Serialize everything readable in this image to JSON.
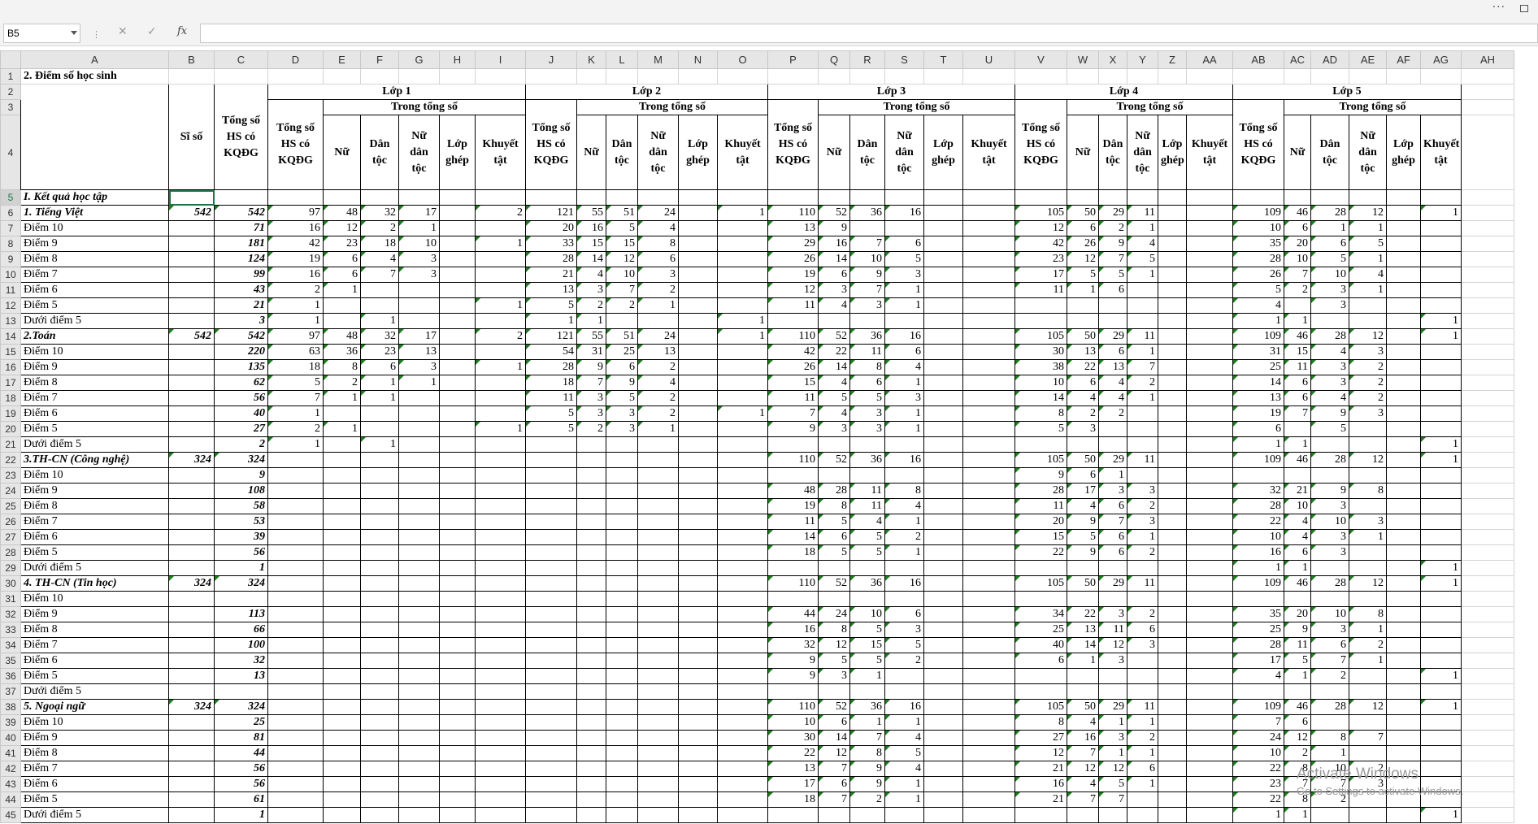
{
  "formula_bar": {
    "name_box": "B5",
    "fx": "fx",
    "formula": ""
  },
  "columns": [
    "A",
    "B",
    "C",
    "D",
    "E",
    "F",
    "G",
    "H",
    "I",
    "J",
    "K",
    "L",
    "M",
    "N",
    "O",
    "P",
    "Q",
    "R",
    "S",
    "T",
    "U",
    "V",
    "W",
    "X",
    "Y",
    "Z",
    "AA",
    "AB",
    "AC",
    "AD",
    "AE",
    "AF",
    "AG",
    "AH"
  ],
  "sheet_title": "2. Điểm số học sinh",
  "header": {
    "si_so": "Sĩ số",
    "tong_so": "Tổng số HS có KQĐG",
    "trong_tong_so": "Trong tổng số",
    "sub": [
      "Nữ",
      "Dân tộc",
      "Nữ dân tộc",
      "Lớp ghép",
      "Khuyết tật"
    ],
    "classes": [
      "Lớp 1",
      "Lớp 2",
      "Lớp 3",
      "Lớp 4",
      "Lớp 5"
    ]
  },
  "rows": [
    {
      "n": 5,
      "label": "I. Kết quả học tập",
      "style": "bi",
      "v": []
    },
    {
      "n": 6,
      "label": "1. Tiếng Việt",
      "style": "bi",
      "v": [
        "542",
        "542",
        "97",
        "48",
        "32",
        "17",
        "",
        "2",
        "121",
        "55",
        "51",
        "24",
        "",
        "1",
        "110",
        "52",
        "36",
        "16",
        "",
        "",
        "105",
        "50",
        "29",
        "11",
        "",
        "",
        "109",
        "46",
        "28",
        "12",
        "",
        "1"
      ]
    },
    {
      "n": 7,
      "label": "Điểm 10",
      "v": [
        "",
        "71",
        "16",
        "12",
        "2",
        "1",
        "",
        "",
        "20",
        "16",
        "5",
        "4",
        "",
        "",
        "13",
        "9",
        "",
        "",
        "",
        "",
        "12",
        "6",
        "2",
        "1",
        "",
        "",
        "10",
        "6",
        "1",
        "1",
        "",
        ""
      ]
    },
    {
      "n": 8,
      "label": "Điểm 9",
      "v": [
        "",
        "181",
        "42",
        "23",
        "18",
        "10",
        "",
        "1",
        "33",
        "15",
        "15",
        "8",
        "",
        "",
        "29",
        "16",
        "7",
        "6",
        "",
        "",
        "42",
        "26",
        "9",
        "4",
        "",
        "",
        "35",
        "20",
        "6",
        "5",
        "",
        ""
      ]
    },
    {
      "n": 9,
      "label": "Điểm 8",
      "v": [
        "",
        "124",
        "19",
        "6",
        "4",
        "3",
        "",
        "",
        "28",
        "14",
        "12",
        "6",
        "",
        "",
        "26",
        "14",
        "10",
        "5",
        "",
        "",
        "23",
        "12",
        "7",
        "5",
        "",
        "",
        "28",
        "10",
        "5",
        "1",
        "",
        ""
      ]
    },
    {
      "n": 10,
      "label": "Điểm 7",
      "v": [
        "",
        "99",
        "16",
        "6",
        "7",
        "3",
        "",
        "",
        "21",
        "4",
        "10",
        "3",
        "",
        "",
        "19",
        "6",
        "9",
        "3",
        "",
        "",
        "17",
        "5",
        "5",
        "1",
        "",
        "",
        "26",
        "7",
        "10",
        "4",
        "",
        ""
      ]
    },
    {
      "n": 11,
      "label": "Điểm 6",
      "v": [
        "",
        "43",
        "2",
        "1",
        "",
        "",
        "",
        "",
        "13",
        "3",
        "7",
        "2",
        "",
        "",
        "12",
        "3",
        "7",
        "1",
        "",
        "",
        "11",
        "1",
        "6",
        "",
        "",
        "",
        "5",
        "2",
        "3",
        "1",
        "",
        ""
      ]
    },
    {
      "n": 12,
      "label": "Điểm 5",
      "v": [
        "",
        "21",
        "1",
        "",
        "",
        "",
        "",
        "1",
        "5",
        "2",
        "2",
        "1",
        "",
        "",
        "11",
        "4",
        "3",
        "1",
        "",
        "",
        "",
        "",
        "",
        "",
        "",
        "",
        "4",
        "",
        "3",
        "",
        "",
        ""
      ]
    },
    {
      "n": 13,
      "label": "Dưới điểm 5",
      "v": [
        "",
        "3",
        "1",
        "",
        "1",
        "",
        "",
        "",
        "1",
        "1",
        "",
        "",
        "",
        "1",
        "",
        "",
        "",
        "",
        "",
        "",
        "",
        "",
        "",
        "",
        "",
        "",
        "1",
        "1",
        "",
        "",
        "",
        "1"
      ]
    },
    {
      "n": 14,
      "label": "2.Toán",
      "style": "bi",
      "v": [
        "542",
        "542",
        "97",
        "48",
        "32",
        "17",
        "",
        "2",
        "121",
        "55",
        "51",
        "24",
        "",
        "1",
        "110",
        "52",
        "36",
        "16",
        "",
        "",
        "105",
        "50",
        "29",
        "11",
        "",
        "",
        "109",
        "46",
        "28",
        "12",
        "",
        "1"
      ]
    },
    {
      "n": 15,
      "label": "Điểm 10",
      "v": [
        "",
        "220",
        "63",
        "36",
        "23",
        "13",
        "",
        "",
        "54",
        "31",
        "25",
        "13",
        "",
        "",
        "42",
        "22",
        "11",
        "6",
        "",
        "",
        "30",
        "13",
        "6",
        "1",
        "",
        "",
        "31",
        "15",
        "4",
        "3",
        "",
        ""
      ]
    },
    {
      "n": 16,
      "label": "Điểm 9",
      "v": [
        "",
        "135",
        "18",
        "8",
        "6",
        "3",
        "",
        "1",
        "28",
        "9",
        "6",
        "2",
        "",
        "",
        "26",
        "14",
        "8",
        "4",
        "",
        "",
        "38",
        "22",
        "13",
        "7",
        "",
        "",
        "25",
        "11",
        "3",
        "2",
        "",
        ""
      ]
    },
    {
      "n": 17,
      "label": "Điểm 8",
      "v": [
        "",
        "62",
        "5",
        "2",
        "1",
        "1",
        "",
        "",
        "18",
        "7",
        "9",
        "4",
        "",
        "",
        "15",
        "4",
        "6",
        "1",
        "",
        "",
        "10",
        "6",
        "4",
        "2",
        "",
        "",
        "14",
        "6",
        "3",
        "2",
        "",
        ""
      ]
    },
    {
      "n": 18,
      "label": "Điểm 7",
      "v": [
        "",
        "56",
        "7",
        "1",
        "1",
        "",
        "",
        "",
        "11",
        "3",
        "5",
        "2",
        "",
        "",
        "11",
        "5",
        "5",
        "3",
        "",
        "",
        "14",
        "4",
        "4",
        "1",
        "",
        "",
        "13",
        "6",
        "4",
        "2",
        "",
        ""
      ]
    },
    {
      "n": 19,
      "label": "Điểm 6",
      "v": [
        "",
        "40",
        "1",
        "",
        "",
        "",
        "",
        "",
        "5",
        "3",
        "3",
        "2",
        "",
        "1",
        "7",
        "4",
        "3",
        "1",
        "",
        "",
        "8",
        "2",
        "2",
        "",
        "",
        "",
        "19",
        "7",
        "9",
        "3",
        "",
        ""
      ]
    },
    {
      "n": 20,
      "label": "Điểm 5",
      "v": [
        "",
        "27",
        "2",
        "1",
        "",
        "",
        "",
        "1",
        "5",
        "2",
        "3",
        "1",
        "",
        "",
        "9",
        "3",
        "3",
        "1",
        "",
        "",
        "5",
        "3",
        "",
        "",
        "",
        "",
        "6",
        "",
        "5",
        "",
        "",
        ""
      ]
    },
    {
      "n": 21,
      "label": "Dưới điểm 5",
      "v": [
        "",
        "2",
        "1",
        "",
        "1",
        "",
        "",
        "",
        "",
        "",
        "",
        "",
        "",
        "",
        "",
        "",
        "",
        "",
        "",
        "",
        "",
        "",
        "",
        "",
        "",
        "",
        "1",
        "1",
        "",
        "",
        "",
        "1"
      ]
    },
    {
      "n": 22,
      "label": "3.TH-CN (Công nghệ)",
      "style": "bi",
      "v": [
        "324",
        "324",
        "",
        "",
        "",
        "",
        "",
        "",
        "",
        "",
        "",
        "",
        "",
        "",
        "110",
        "52",
        "36",
        "16",
        "",
        "",
        "105",
        "50",
        "29",
        "11",
        "",
        "",
        "109",
        "46",
        "28",
        "12",
        "",
        "1"
      ]
    },
    {
      "n": 23,
      "label": "Điểm 10",
      "v": [
        "",
        "9",
        "",
        "",
        "",
        "",
        "",
        "",
        "",
        "",
        "",
        "",
        "",
        "",
        "",
        "",
        "",
        "",
        "",
        "",
        "9",
        "6",
        "1",
        "",
        "",
        "",
        "",
        "",
        "",
        "",
        "",
        ""
      ]
    },
    {
      "n": 24,
      "label": "Điểm 9",
      "v": [
        "",
        "108",
        "",
        "",
        "",
        "",
        "",
        "",
        "",
        "",
        "",
        "",
        "",
        "",
        "48",
        "28",
        "11",
        "8",
        "",
        "",
        "28",
        "17",
        "3",
        "3",
        "",
        "",
        "32",
        "21",
        "9",
        "8",
        "",
        ""
      ]
    },
    {
      "n": 25,
      "label": "Điểm 8",
      "v": [
        "",
        "58",
        "",
        "",
        "",
        "",
        "",
        "",
        "",
        "",
        "",
        "",
        "",
        "",
        "19",
        "8",
        "11",
        "4",
        "",
        "",
        "11",
        "4",
        "6",
        "2",
        "",
        "",
        "28",
        "10",
        "3",
        "",
        "",
        ""
      ]
    },
    {
      "n": 26,
      "label": "Điểm 7",
      "v": [
        "",
        "53",
        "",
        "",
        "",
        "",
        "",
        "",
        "",
        "",
        "",
        "",
        "",
        "",
        "11",
        "5",
        "4",
        "1",
        "",
        "",
        "20",
        "9",
        "7",
        "3",
        "",
        "",
        "22",
        "4",
        "10",
        "3",
        "",
        ""
      ]
    },
    {
      "n": 27,
      "label": "Điểm 6",
      "v": [
        "",
        "39",
        "",
        "",
        "",
        "",
        "",
        "",
        "",
        "",
        "",
        "",
        "",
        "",
        "14",
        "6",
        "5",
        "2",
        "",
        "",
        "15",
        "5",
        "6",
        "1",
        "",
        "",
        "10",
        "4",
        "3",
        "1",
        "",
        ""
      ]
    },
    {
      "n": 28,
      "label": "Điểm 5",
      "v": [
        "",
        "56",
        "",
        "",
        "",
        "",
        "",
        "",
        "",
        "",
        "",
        "",
        "",
        "",
        "18",
        "5",
        "5",
        "1",
        "",
        "",
        "22",
        "9",
        "6",
        "2",
        "",
        "",
        "16",
        "6",
        "3",
        "",
        "",
        ""
      ]
    },
    {
      "n": 29,
      "label": "Dưới điểm 5",
      "v": [
        "",
        "1",
        "",
        "",
        "",
        "",
        "",
        "",
        "",
        "",
        "",
        "",
        "",
        "",
        "",
        "",
        "",
        "",
        "",
        "",
        "",
        "",
        "",
        "",
        "",
        "",
        "1",
        "1",
        "",
        "",
        "",
        "1"
      ]
    },
    {
      "n": 30,
      "label": "4. TH-CN (Tin học)",
      "style": "bi",
      "v": [
        "324",
        "324",
        "",
        "",
        "",
        "",
        "",
        "",
        "",
        "",
        "",
        "",
        "",
        "",
        "110",
        "52",
        "36",
        "16",
        "",
        "",
        "105",
        "50",
        "29",
        "11",
        "",
        "",
        "109",
        "46",
        "28",
        "12",
        "",
        "1"
      ]
    },
    {
      "n": 31,
      "label": "Điểm 10",
      "v": []
    },
    {
      "n": 32,
      "label": "Điểm 9",
      "v": [
        "",
        "113",
        "",
        "",
        "",
        "",
        "",
        "",
        "",
        "",
        "",
        "",
        "",
        "",
        "44",
        "24",
        "10",
        "6",
        "",
        "",
        "34",
        "22",
        "3",
        "2",
        "",
        "",
        "35",
        "20",
        "10",
        "8",
        "",
        ""
      ]
    },
    {
      "n": 33,
      "label": "Điểm 8",
      "v": [
        "",
        "66",
        "",
        "",
        "",
        "",
        "",
        "",
        "",
        "",
        "",
        "",
        "",
        "",
        "16",
        "8",
        "5",
        "3",
        "",
        "",
        "25",
        "13",
        "11",
        "6",
        "",
        "",
        "25",
        "9",
        "3",
        "1",
        "",
        ""
      ]
    },
    {
      "n": 34,
      "label": "Điểm 7",
      "v": [
        "",
        "100",
        "",
        "",
        "",
        "",
        "",
        "",
        "",
        "",
        "",
        "",
        "",
        "",
        "32",
        "12",
        "15",
        "5",
        "",
        "",
        "40",
        "14",
        "12",
        "3",
        "",
        "",
        "28",
        "11",
        "6",
        "2",
        "",
        ""
      ]
    },
    {
      "n": 35,
      "label": "Điểm 6",
      "v": [
        "",
        "32",
        "",
        "",
        "",
        "",
        "",
        "",
        "",
        "",
        "",
        "",
        "",
        "",
        "9",
        "5",
        "5",
        "2",
        "",
        "",
        "6",
        "1",
        "3",
        "",
        "",
        "",
        "17",
        "5",
        "7",
        "1",
        "",
        ""
      ]
    },
    {
      "n": 36,
      "label": "Điểm 5",
      "v": [
        "",
        "13",
        "",
        "",
        "",
        "",
        "",
        "",
        "",
        "",
        "",
        "",
        "",
        "",
        "9",
        "3",
        "1",
        "",
        "",
        "",
        "",
        "",
        "",
        "",
        "",
        "",
        "4",
        "1",
        "2",
        "",
        "",
        "1"
      ]
    },
    {
      "n": 37,
      "label": "Dưới điểm 5",
      "v": []
    },
    {
      "n": 38,
      "label": "5. Ngoại ngữ",
      "style": "bi",
      "v": [
        "324",
        "324",
        "",
        "",
        "",
        "",
        "",
        "",
        "",
        "",
        "",
        "",
        "",
        "",
        "110",
        "52",
        "36",
        "16",
        "",
        "",
        "105",
        "50",
        "29",
        "11",
        "",
        "",
        "109",
        "46",
        "28",
        "12",
        "",
        "1"
      ]
    },
    {
      "n": 39,
      "label": "Điểm 10",
      "v": [
        "",
        "25",
        "",
        "",
        "",
        "",
        "",
        "",
        "",
        "",
        "",
        "",
        "",
        "",
        "10",
        "6",
        "1",
        "1",
        "",
        "",
        "8",
        "4",
        "1",
        "1",
        "",
        "",
        "7",
        "6",
        "",
        "",
        "",
        ""
      ]
    },
    {
      "n": 40,
      "label": "Điểm 9",
      "v": [
        "",
        "81",
        "",
        "",
        "",
        "",
        "",
        "",
        "",
        "",
        "",
        "",
        "",
        "",
        "30",
        "14",
        "7",
        "4",
        "",
        "",
        "27",
        "16",
        "3",
        "2",
        "",
        "",
        "24",
        "12",
        "8",
        "7",
        "",
        ""
      ]
    },
    {
      "n": 41,
      "label": "Điểm 8",
      "v": [
        "",
        "44",
        "",
        "",
        "",
        "",
        "",
        "",
        "",
        "",
        "",
        "",
        "",
        "",
        "22",
        "12",
        "8",
        "5",
        "",
        "",
        "12",
        "7",
        "1",
        "1",
        "",
        "",
        "10",
        "2",
        "1",
        "",
        "",
        ""
      ]
    },
    {
      "n": 42,
      "label": "Điểm 7",
      "v": [
        "",
        "56",
        "",
        "",
        "",
        "",
        "",
        "",
        "",
        "",
        "",
        "",
        "",
        "",
        "13",
        "7",
        "9",
        "4",
        "",
        "",
        "21",
        "12",
        "12",
        "6",
        "",
        "",
        "22",
        "8",
        "10",
        "2",
        "",
        ""
      ]
    },
    {
      "n": 43,
      "label": "Điểm 6",
      "v": [
        "",
        "56",
        "",
        "",
        "",
        "",
        "",
        "",
        "",
        "",
        "",
        "",
        "",
        "",
        "17",
        "6",
        "9",
        "1",
        "",
        "",
        "16",
        "4",
        "5",
        "1",
        "",
        "",
        "23",
        "7",
        "7",
        "3",
        "",
        ""
      ]
    },
    {
      "n": 44,
      "label": "Điểm 5",
      "v": [
        "",
        "61",
        "",
        "",
        "",
        "",
        "",
        "",
        "",
        "",
        "",
        "",
        "",
        "",
        "18",
        "7",
        "2",
        "1",
        "",
        "",
        "21",
        "7",
        "7",
        "",
        "",
        "",
        "22",
        "8",
        "2",
        "",
        "",
        ""
      ]
    },
    {
      "n": 45,
      "label": "Dưới điểm 5",
      "v": [
        "",
        "1",
        "",
        "",
        "",
        "",
        "",
        "",
        "",
        "",
        "",
        "",
        "",
        "",
        "",
        "",
        "",
        "",
        "",
        "",
        "",
        "",
        "",
        "",
        "",
        "",
        "1",
        "1",
        "",
        "",
        "",
        "1"
      ]
    }
  ],
  "watermark": {
    "line1": "Activate Windows",
    "line2": "Go to Settings to activate Windows."
  }
}
